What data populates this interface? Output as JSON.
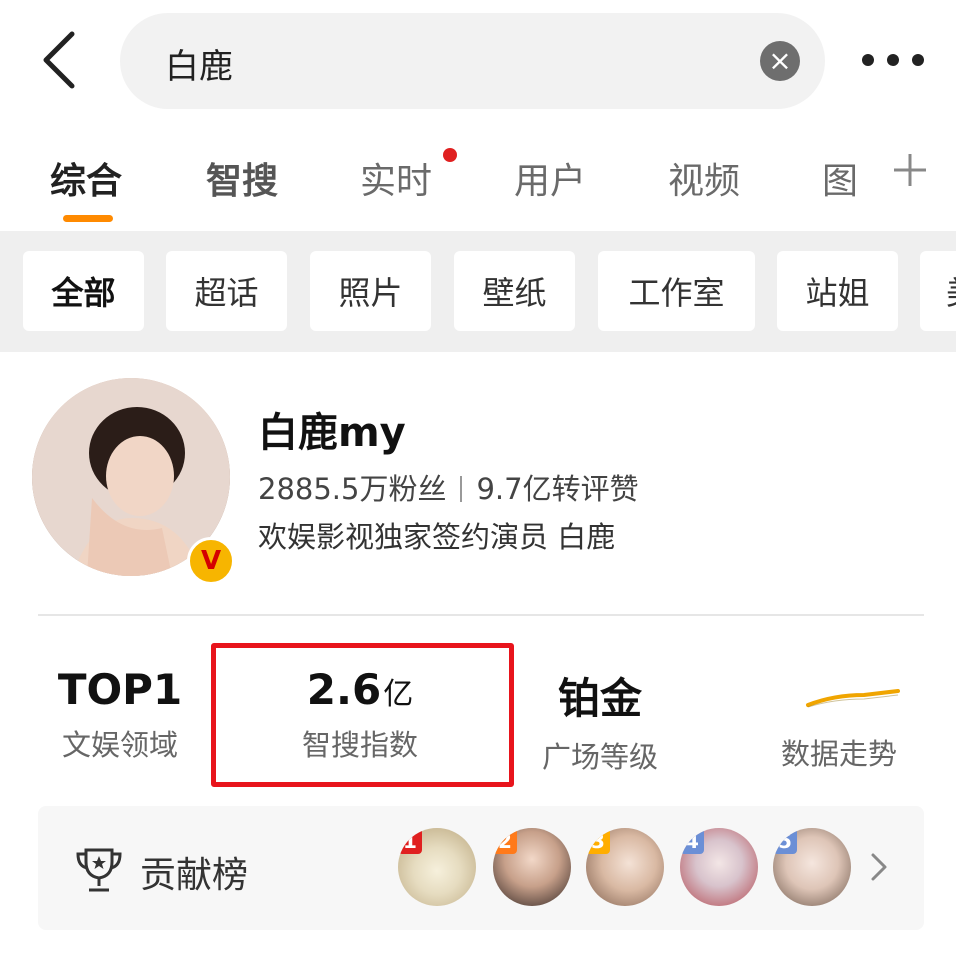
{
  "search": {
    "query": "白鹿",
    "clear_icon": "close-circle-icon"
  },
  "tabs": [
    {
      "label": "综合",
      "active": true
    },
    {
      "label": "智搜"
    },
    {
      "label": "实时",
      "badge_dot": true
    },
    {
      "label": "用户"
    },
    {
      "label": "视频"
    },
    {
      "label": "图"
    }
  ],
  "filters": [
    "全部",
    "超话",
    "照片",
    "壁纸",
    "工作室",
    "站姐",
    "美"
  ],
  "profile": {
    "name": "白鹿my",
    "fans": "2885.5万粉丝",
    "interactions": "9.7亿转评赞",
    "description": "欢娱影视独家签约演员 白鹿",
    "verified_badge": "V"
  },
  "metrics": {
    "rank": {
      "value": "TOP1",
      "label": "文娱领域"
    },
    "index": {
      "value": "2.6",
      "unit": "亿",
      "label": "智搜指数"
    },
    "level": {
      "value": "铂金",
      "label": "广场等级"
    },
    "trend": {
      "label": "数据走势"
    }
  },
  "contribution": {
    "label": "贡献榜",
    "ranks": [
      "1",
      "2",
      "3",
      "4",
      "5"
    ]
  },
  "colors": {
    "accent": "#ff8a00",
    "highlight": "#e8141c",
    "rank1": "#e02020",
    "rank2": "#ff7a1a",
    "rank3": "#ffae00",
    "rank4": "#6b8fd6",
    "rank5": "#6b8fd6"
  }
}
